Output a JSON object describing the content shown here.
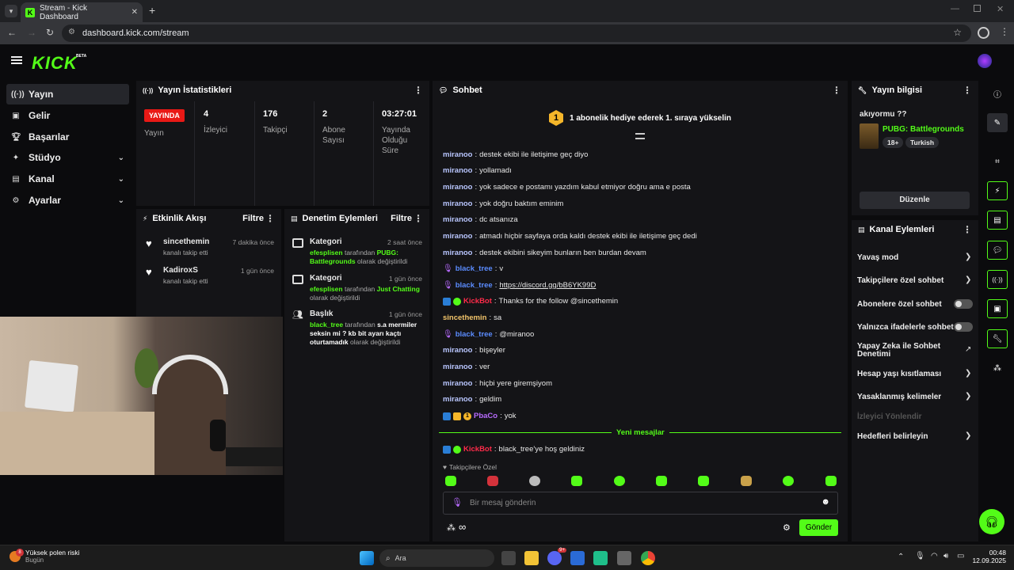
{
  "browser": {
    "tab_title": "Stream - Kick Dashboard",
    "url": "dashboard.kick.com/stream"
  },
  "app": {
    "logo": "KICK",
    "logo_beta": "BETA"
  },
  "sidebar": {
    "items": [
      {
        "label": "Yayın",
        "icon": "broadcast-icon"
      },
      {
        "label": "Gelir",
        "icon": "wallet-icon"
      },
      {
        "label": "Başarılar",
        "icon": "trophy-icon"
      },
      {
        "label": "Stüdyo",
        "icon": "studio-icon"
      },
      {
        "label": "Kanal",
        "icon": "channel-icon"
      },
      {
        "label": "Ayarlar",
        "icon": "gear-icon"
      }
    ]
  },
  "stats": {
    "title": "Yayın İstatistikleri",
    "live_badge": "YAYINDA",
    "live_label": "Yayın",
    "viewers_value": "4",
    "viewers_label": "İzleyici",
    "followers_value": "176",
    "followers_label": "Takipçi",
    "subs_value": "2",
    "subs_label": "Abone Sayısı",
    "uptime_value": "03:27:01",
    "uptime_label": "Yayında Olduğu Süre"
  },
  "activity": {
    "title": "Etkinlik Akışı",
    "filter": "Filtre",
    "items": [
      {
        "name": "sincethemin",
        "action": "kanalı takip etti",
        "time": "7 dakika önce"
      },
      {
        "name": "KadiroxS",
        "action": "kanalı takip etti",
        "time": "1 gün önce"
      }
    ]
  },
  "moderation": {
    "title": "Denetim Eylemleri",
    "filter": "Filtre",
    "items": [
      {
        "title": "Kategori",
        "time": "2 saat önce",
        "user": "efesplisen",
        "by": "tarafından",
        "value": "PUBG: Battlegrounds",
        "suffix": "olarak değiştirildi"
      },
      {
        "title": "Kategori",
        "time": "1 gün önce",
        "user": "efesplisen",
        "by": "tarafından",
        "value": "Just Chatting",
        "suffix": "olarak değiştirildi"
      },
      {
        "title": "Başlık",
        "time": "1 gün önce",
        "user": "black_tree",
        "by": "tarafından",
        "value": "s.a mermiler seksin mi ? kb bit ayarı kaçtı oturtamadık",
        "suffix": "olarak değiştirildi"
      }
    ]
  },
  "chat": {
    "title": "Sohbet",
    "pinned_number": "1",
    "pinned_text": "1 abonelik hediye ederek 1. sıraya yükselin",
    "new_messages": "Yeni mesajlar",
    "followers_only": "Takipçilere Özel",
    "input_placeholder": "Bir mesaj gönderin",
    "send": "Gönder",
    "messages": [
      {
        "user": "miranoo",
        "text": "destek ekibi ile iletişime geç diyo"
      },
      {
        "user": "miranoo",
        "text": "yollamadı"
      },
      {
        "user": "miranoo",
        "text": "yok sadece e postamı yazdım kabul etmiyor doğru ama e posta"
      },
      {
        "user": "miranoo",
        "text": "yok doğru baktım eminim"
      },
      {
        "user": "miranoo",
        "text": "dc atsanıza"
      },
      {
        "user": "miranoo",
        "text": "atmadı hiçbir sayfaya orda kaldı destek ekibi ile iletişime geç dedi"
      },
      {
        "user": "miranoo",
        "text": "destek ekibini sikeyim bunların ben burdan devam"
      },
      {
        "user": "black_tree",
        "text": "v"
      },
      {
        "user": "black_tree",
        "text": "https://discord.gg/bB6YK99D"
      },
      {
        "user": "KickBot",
        "text": "Thanks for the follow @sincethemin"
      },
      {
        "user": "sincethemin",
        "text": "sa"
      },
      {
        "user": "black_tree",
        "text": "@miranoo"
      },
      {
        "user": "miranoo",
        "text": "bişeyler"
      },
      {
        "user": "miranoo",
        "text": "ver"
      },
      {
        "user": "miranoo",
        "text": "hiçbi yere giremşiyom"
      },
      {
        "user": "miranoo",
        "text": "geldim"
      },
      {
        "user": "PbaCo",
        "text": "yok"
      },
      {
        "user": "KickBot",
        "text": "black_tree'ye hoş geldiniz"
      }
    ],
    "colors": {
      "miranoo": "#b9c6ff",
      "black_tree": "#5b8cff",
      "KickBot": "#ff2b4a",
      "sincethemin": "#f3c56b",
      "PbaCo": "#b86bff"
    },
    "sub_badge_number": "1"
  },
  "stream_info": {
    "title": "Yayın bilgisi",
    "stream_title": "akıyormu ??",
    "category": "PUBG: Battlegrounds",
    "tag_age": "18+",
    "tag_lang": "Turkish",
    "edit": "Düzenle"
  },
  "channel_actions": {
    "title": "Kanal Eylemleri",
    "slow": "Yavaş mod",
    "followers_chat": "Takipçilere özel sohbet",
    "subs_chat": "Abonelere özel sohbet",
    "emote_only": "Yalnızca ifadelerle sohbet",
    "ai_mod": "Yapay Zeka ile Sohbet Denetimi",
    "age_restrict": "Hesap yaşı kısıtlaması",
    "banned_words": "Yasaklanmış kelimeler",
    "viewer_redirect": "İzleyici Yönlendir",
    "goals": "Hedefleri belirleyin"
  },
  "taskbar": {
    "weather_title": "Yüksek polen riski",
    "weather_sub": "Bugün",
    "weather_badge": "8",
    "search": "Ara",
    "time": "00:48",
    "date": "12.09.2025",
    "discord_badge": "9+"
  }
}
